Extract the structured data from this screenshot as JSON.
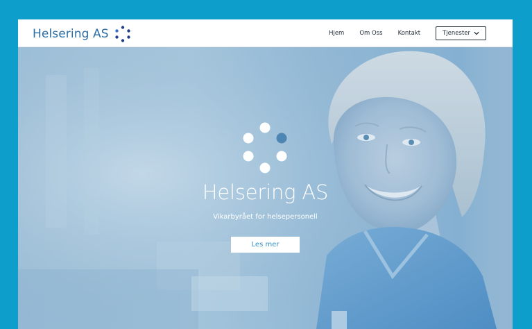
{
  "brand": {
    "name": "Helsering AS",
    "logo_icon": "dots-ring-icon",
    "color": "#2c6ea6",
    "dot_color": "#1f3f8a"
  },
  "nav": {
    "links": [
      {
        "label": "Hjem"
      },
      {
        "label": "Om Oss"
      },
      {
        "label": "Kontakt"
      }
    ],
    "dropdown": {
      "label": "Tjenester",
      "icon": "chevron-down-icon"
    }
  },
  "hero": {
    "title": "Helsering AS",
    "subtitle": "Vikarbyrået for helsepersonell",
    "button_label": "Les mer",
    "spinner_icon": "loading-dots-icon",
    "accent": "#2f8fc9",
    "frame_color": "#0e9ecb"
  }
}
